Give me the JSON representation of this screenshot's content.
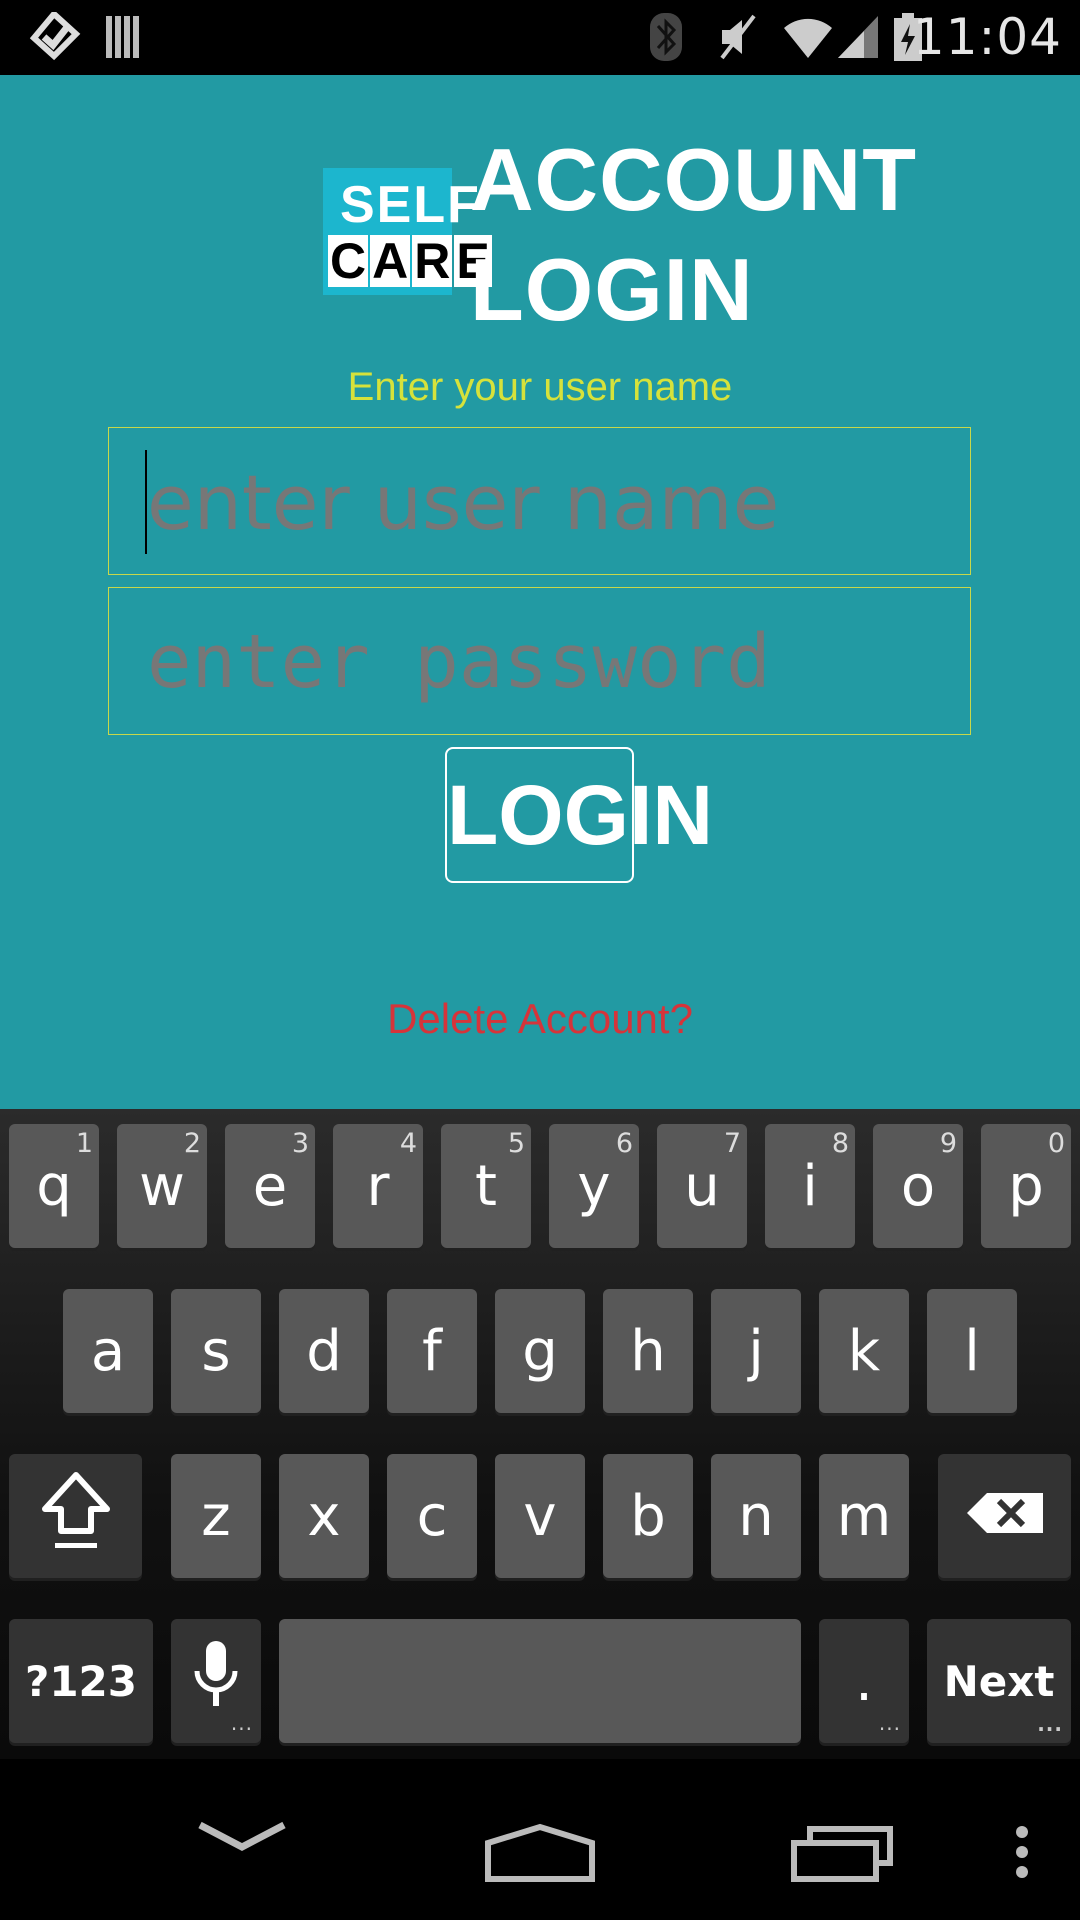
{
  "status_bar": {
    "time": "11:04",
    "left_icons": [
      "task-check-icon",
      "barcode-icon"
    ],
    "right_icons": [
      "bluetooth-icon",
      "mute-icon",
      "wifi-icon",
      "signal-icon",
      "battery-charging-icon"
    ]
  },
  "app": {
    "logo_top": "SELF",
    "logo_bottom": [
      "C",
      "A",
      "R",
      "E"
    ],
    "title_line1": "ACCOUNT",
    "title_line2": "LOGIN",
    "prompt": "Enter your user name",
    "username_placeholder": "enter user name",
    "password_placeholder": "enter password",
    "login_label": "LOGIN",
    "delete_label": "Delete Account?",
    "colors": {
      "background": "#229aa3",
      "prompt": "#d6e23b",
      "delete": "#d6343a"
    }
  },
  "keyboard": {
    "row1": [
      {
        "label": "q",
        "hint": "1"
      },
      {
        "label": "w",
        "hint": "2"
      },
      {
        "label": "e",
        "hint": "3"
      },
      {
        "label": "r",
        "hint": "4"
      },
      {
        "label": "t",
        "hint": "5"
      },
      {
        "label": "y",
        "hint": "6"
      },
      {
        "label": "u",
        "hint": "7"
      },
      {
        "label": "i",
        "hint": "8"
      },
      {
        "label": "o",
        "hint": "9"
      },
      {
        "label": "p",
        "hint": "0"
      }
    ],
    "row2": [
      "a",
      "s",
      "d",
      "f",
      "g",
      "h",
      "j",
      "k",
      "l"
    ],
    "row3": [
      "z",
      "x",
      "c",
      "v",
      "b",
      "n",
      "m"
    ],
    "symbols_label": "?123",
    "period_label": ".",
    "next_label": "Next",
    "shift_icon": "shift-icon",
    "backspace_icon": "backspace-icon",
    "mic_icon": "microphone-icon"
  },
  "nav_bar": {
    "icons": [
      "back-icon",
      "home-icon",
      "recent-apps-icon",
      "overflow-menu-icon"
    ]
  }
}
